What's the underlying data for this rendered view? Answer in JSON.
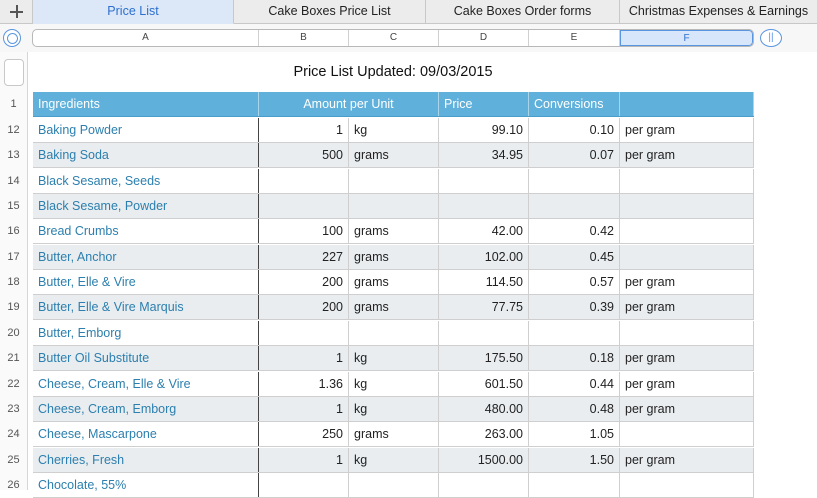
{
  "tabs": [
    {
      "label": "Price List",
      "active": true
    },
    {
      "label": "Cake Boxes Price List",
      "active": false
    },
    {
      "label": "Cake Boxes Order forms",
      "active": false
    },
    {
      "label": "Christmas Expenses & Earnings",
      "active": false
    }
  ],
  "columns": [
    "A",
    "B",
    "C",
    "D",
    "E",
    "F"
  ],
  "selected_column": "F",
  "icons": {
    "add_sheet": "plus-icon",
    "select_all": "select-all-icon",
    "freeze": "freeze-columns-icon"
  },
  "colors": {
    "header_fill": "#5fb0da",
    "ingredient_text": "#2c7fae",
    "accent": "#2c6fce",
    "alt_row": "#e9edf0"
  },
  "sheet": {
    "title": "Price List Updated: 09/03/2015",
    "header_row_number": "1",
    "headers": [
      "Ingredients",
      "Amount per Unit",
      "Price",
      "Conversions"
    ],
    "rows": [
      {
        "n": "12",
        "ingredient": "Baking Powder",
        "amount": "1",
        "unit": "kg",
        "price": "99.10",
        "conversion": "0.10",
        "per": "per gram"
      },
      {
        "n": "13",
        "ingredient": "Baking Soda",
        "amount": "500",
        "unit": "grams",
        "price": "34.95",
        "conversion": "0.07",
        "per": "per gram"
      },
      {
        "n": "14",
        "ingredient": "Black Sesame, Seeds",
        "amount": "",
        "unit": "",
        "price": "",
        "conversion": "",
        "per": ""
      },
      {
        "n": "15",
        "ingredient": "Black Sesame, Powder",
        "amount": "",
        "unit": "",
        "price": "",
        "conversion": "",
        "per": ""
      },
      {
        "n": "16",
        "ingredient": "Bread Crumbs",
        "amount": "100",
        "unit": "grams",
        "price": "42.00",
        "conversion": "0.42",
        "per": ""
      },
      {
        "n": "17",
        "ingredient": "Butter, Anchor",
        "amount": "227",
        "unit": "grams",
        "price": "102.00",
        "conversion": "0.45",
        "per": ""
      },
      {
        "n": "18",
        "ingredient": "Butter, Elle & Vire",
        "amount": "200",
        "unit": "grams",
        "price": "114.50",
        "conversion": "0.57",
        "per": "per gram"
      },
      {
        "n": "19",
        "ingredient": "Butter, Elle & Vire Marquis",
        "amount": "200",
        "unit": "grams",
        "price": "77.75",
        "conversion": "0.39",
        "per": "per gram"
      },
      {
        "n": "20",
        "ingredient": "Butter, Emborg",
        "amount": "",
        "unit": "",
        "price": "",
        "conversion": "",
        "per": ""
      },
      {
        "n": "21",
        "ingredient": "Butter Oil Substitute",
        "amount": "1",
        "unit": "kg",
        "price": "175.50",
        "conversion": "0.18",
        "per": "per gram"
      },
      {
        "n": "22",
        "ingredient": "Cheese, Cream, Elle & Vire",
        "amount": "1.36",
        "unit": "kg",
        "price": "601.50",
        "conversion": "0.44",
        "per": "per gram"
      },
      {
        "n": "23",
        "ingredient": "Cheese, Cream, Emborg",
        "amount": "1",
        "unit": "kg",
        "price": "480.00",
        "conversion": "0.48",
        "per": "per gram"
      },
      {
        "n": "24",
        "ingredient": "Cheese, Mascarpone",
        "amount": "250",
        "unit": "grams",
        "price": "263.00",
        "conversion": "1.05",
        "per": ""
      },
      {
        "n": "25",
        "ingredient": "Cherries, Fresh",
        "amount": "1",
        "unit": "kg",
        "price": "1500.00",
        "conversion": "1.50",
        "per": "per gram"
      },
      {
        "n": "26",
        "ingredient": "Chocolate, 55%",
        "amount": "",
        "unit": "",
        "price": "",
        "conversion": "",
        "per": ""
      }
    ]
  }
}
